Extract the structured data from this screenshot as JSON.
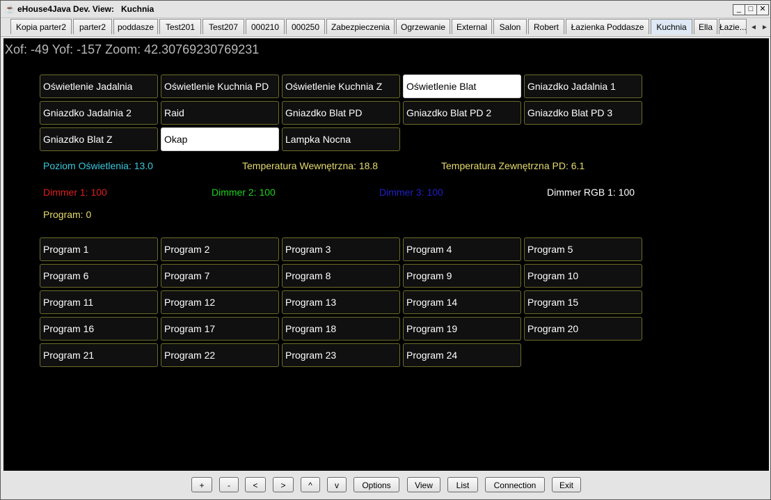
{
  "window": {
    "title": "eHouse4Java Dev. View:   Kuchnia",
    "controls": {
      "minimize": "_",
      "maximize": "□",
      "close": "✕"
    }
  },
  "tabs": [
    {
      "label": "Kopia parter2",
      "active": false
    },
    {
      "label": "parter2",
      "active": false
    },
    {
      "label": "poddasze",
      "active": false
    },
    {
      "label": "Test201",
      "active": false
    },
    {
      "label": "Test207",
      "active": false
    },
    {
      "label": "000210",
      "active": false
    },
    {
      "label": "000250",
      "active": false
    },
    {
      "label": "Zabezpieczenia",
      "active": false
    },
    {
      "label": "Ogrzewanie",
      "active": false
    },
    {
      "label": "External",
      "active": false
    },
    {
      "label": "Salon",
      "active": false
    },
    {
      "label": "Robert",
      "active": false
    },
    {
      "label": "Łazienka Poddasze",
      "active": false
    },
    {
      "label": "Kuchnia",
      "active": true
    },
    {
      "label": "Ella",
      "active": false
    },
    {
      "label": "Łazie...",
      "active": false
    }
  ],
  "tab_scroll": {
    "left": "◄",
    "right": "►"
  },
  "canvas": {
    "coords": "Xof: -49 Yof: -157 Zoom: 42.30769230769231",
    "outputs": [
      {
        "label": "Oświetlenie Jadalnia",
        "on": false
      },
      {
        "label": "Oświetlenie Kuchnia PD",
        "on": false
      },
      {
        "label": "Oświetlenie Kuchnia  Z",
        "on": false
      },
      {
        "label": "Oświetlenie Blat",
        "on": true
      },
      {
        "label": "Gniazdko Jadalnia 1",
        "on": false
      },
      {
        "label": "Gniazdko Jadalnia 2",
        "on": false
      },
      {
        "label": "Raid",
        "on": false
      },
      {
        "label": "Gniazdko Blat PD",
        "on": false
      },
      {
        "label": "Gniazdko Blat PD 2",
        "on": false
      },
      {
        "label": "Gniazdko Blat PD 3",
        "on": false
      },
      {
        "label": "Gniazdko Blat Z",
        "on": false
      },
      {
        "label": "Okap",
        "on": true
      },
      {
        "label": "Lampka Nocna",
        "on": false
      }
    ],
    "status": {
      "light_level": {
        "text": "Poziom Oświetlenia: 13.0",
        "color": "#3cc8dc"
      },
      "temp_in": {
        "text": "Temperatura Wewnętrzna: 18.8",
        "color": "#e6dc6e"
      },
      "temp_out": {
        "text": "Temperatura Zewnętrzna PD: 6.1",
        "color": "#e6dc6e"
      },
      "dimmer1": {
        "text": "Dimmer 1: 100",
        "color": "#e01e1e"
      },
      "dimmer2": {
        "text": "Dimmer 2: 100",
        "color": "#1ed21e"
      },
      "dimmer3": {
        "text": "Dimmer 3: 100",
        "color": "#2020c8"
      },
      "dimmer_rgb": {
        "text": "Dimmer RGB 1: 100",
        "color": "#ffffff"
      },
      "program": {
        "text": "Program: 0",
        "color": "#e6dc6e"
      }
    },
    "programs": [
      "Program 1",
      "Program 2",
      "Program 3",
      "Program 4",
      "Program 5",
      "Program 6",
      "Program 7",
      "Program 8",
      "Program 9",
      "Program 10",
      "Program 11",
      "Program 12",
      "Program 13",
      "Program 14",
      "Program 15",
      "Program 16",
      "Program 17",
      "Program 18",
      "Program 19",
      "Program 20",
      "Program 21",
      "Program 22",
      "Program 23",
      "Program 24"
    ]
  },
  "toolbar": {
    "zoom_in": "+",
    "zoom_out": "-",
    "left": "<",
    "right": ">",
    "up": "^",
    "down": "v",
    "options": "Options",
    "view": "View",
    "list": "List",
    "connection": "Connection",
    "exit": "Exit"
  }
}
